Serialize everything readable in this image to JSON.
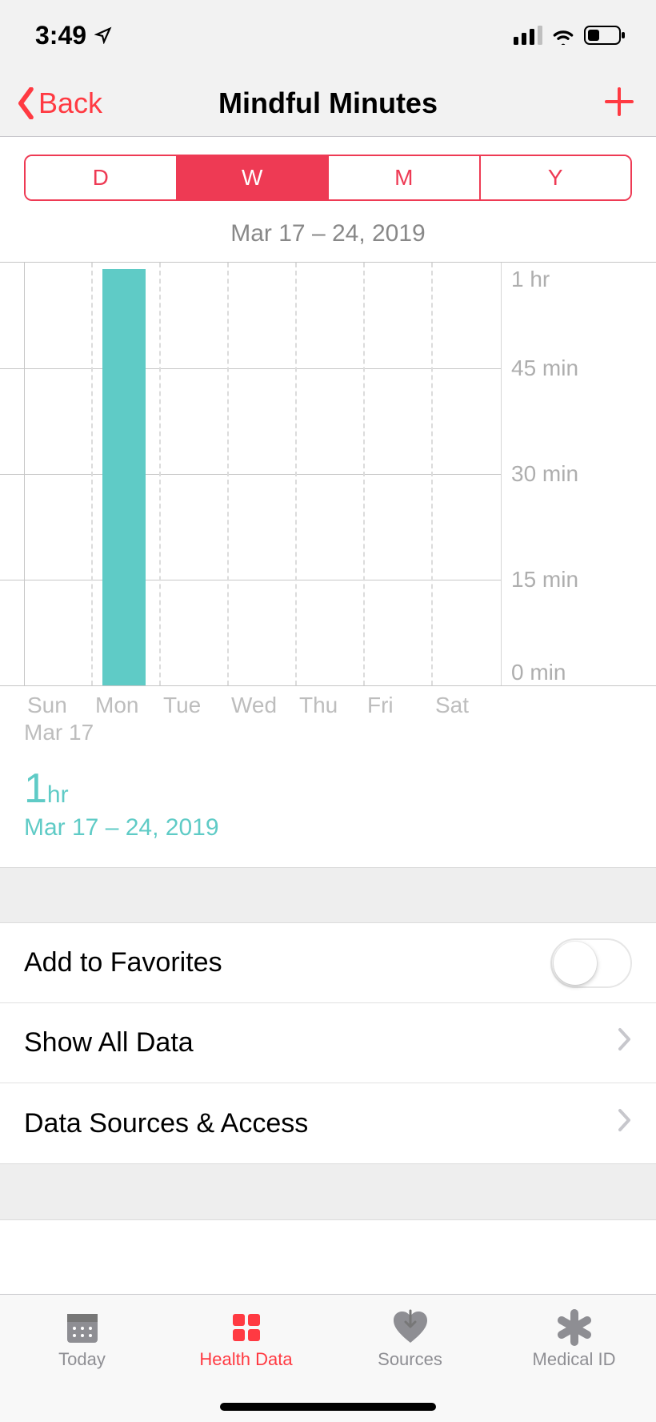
{
  "status": {
    "time": "3:49"
  },
  "nav": {
    "back_label": "Back",
    "title": "Mindful Minutes"
  },
  "segments": {
    "d": "D",
    "w": "W",
    "m": "M",
    "y": "Y",
    "active": "w"
  },
  "date_range": "Mar 17 – 24, 2019",
  "chart_data": {
    "type": "bar",
    "categories": [
      "Sun",
      "Mon",
      "Tue",
      "Wed",
      "Thu",
      "Fri",
      "Sat"
    ],
    "values": [
      0,
      60,
      0,
      0,
      0,
      0,
      0
    ],
    "ylabel_unit": "min",
    "ylim": [
      0,
      60
    ],
    "yticks": [
      {
        "value": 60,
        "label": "1 hr"
      },
      {
        "value": 45,
        "label": "45 min"
      },
      {
        "value": 30,
        "label": "30 min"
      },
      {
        "value": 15,
        "label": "15 min"
      },
      {
        "value": 0,
        "label": "0 min"
      }
    ],
    "x_secondary": "Mar 17"
  },
  "summary": {
    "value_number": "1",
    "value_unit": "hr",
    "range": "Mar 17 – 24, 2019"
  },
  "list": {
    "favorites": "Add to Favorites",
    "show_all": "Show All Data",
    "sources": "Data Sources & Access"
  },
  "tabs": {
    "today": "Today",
    "health": "Health Data",
    "sources": "Sources",
    "medical": "Medical ID"
  }
}
